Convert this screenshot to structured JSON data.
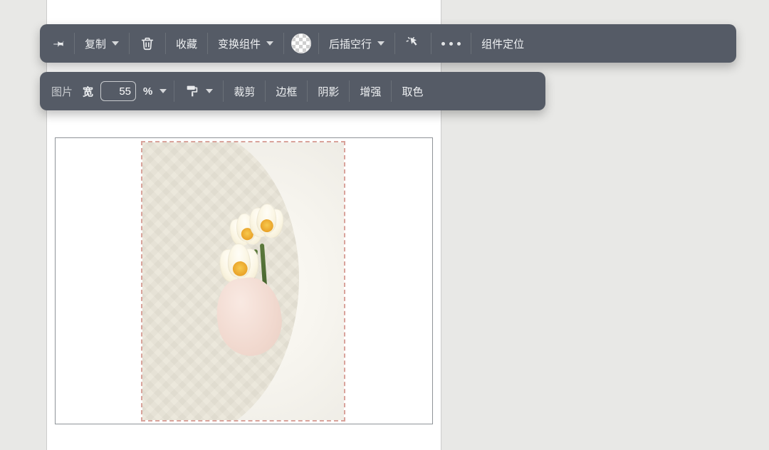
{
  "toolbar_main": {
    "copy_label": "复制",
    "favorite_label": "收藏",
    "transform_label": "变换组件",
    "insert_blank_label": "后插空行",
    "locate_label": "组件定位"
  },
  "toolbar_image": {
    "type_label": "图片",
    "width_label": "宽",
    "width_value": "55",
    "width_unit": "%",
    "crop_label": "裁剪",
    "border_label": "边框",
    "shadow_label": "阴影",
    "enhance_label": "增强",
    "pick_color_label": "取色"
  },
  "image": {
    "width_percent": 55,
    "description": "hand-holding-white-tulips-knit-sweater"
  },
  "colors": {
    "toolbar_bg": "#555b66",
    "page_bg": "#e8e8e6",
    "selection_dash": "#d9a39b"
  }
}
